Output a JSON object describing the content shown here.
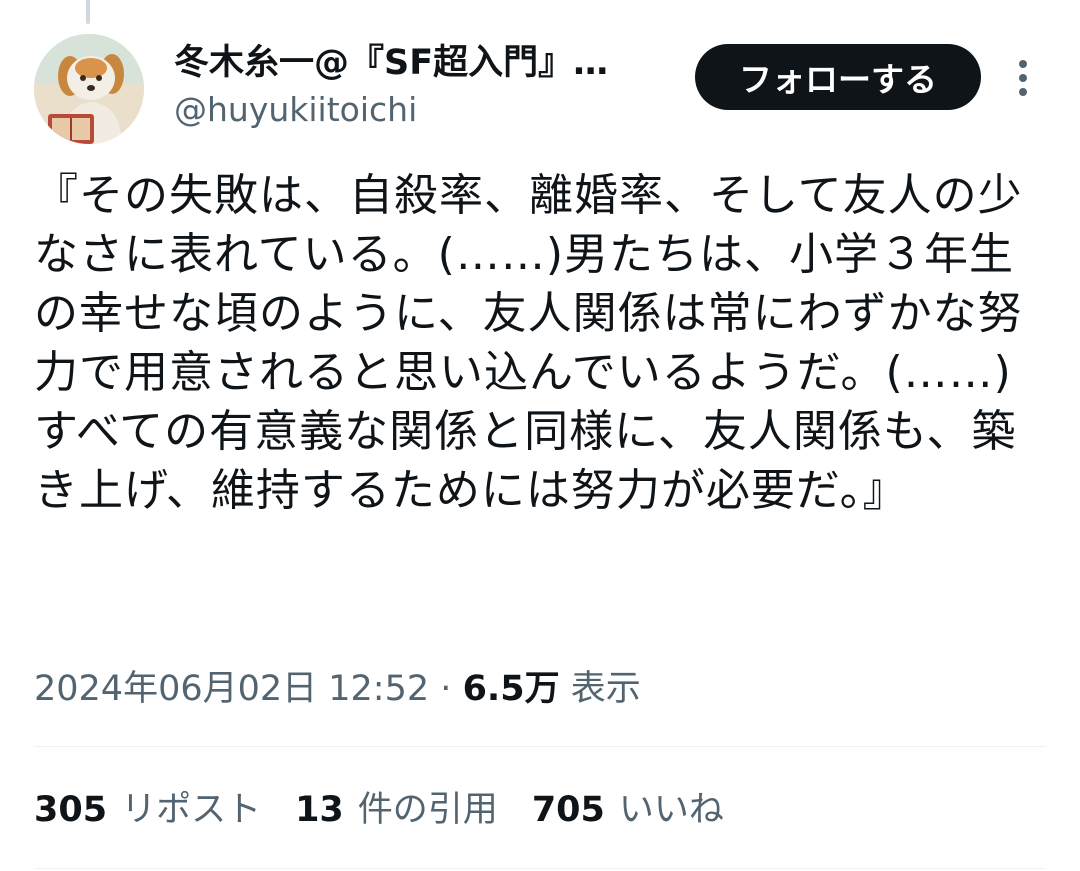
{
  "tweet": {
    "author": {
      "display_name": "冬木糸一@『SF超入門』…",
      "handle": "@huyukiitoichi"
    },
    "follow_label": "フォローする",
    "text": "『その失敗は、自殺率、離婚率、そして友人の少なさに表れている。(……)男たちは、小学３年生の幸せな頃のように、友人関係は常にわずかな努力で用意されると思い込んでいるようだ。(……)すべての有意義な関係と同様に、友人関係も、築き上げ、維持するためには努力が必要だ。』",
    "timestamp": "2024年06月02日 12:52",
    "separator": "·",
    "views_count": "6.5万",
    "views_label": "表示",
    "stats": {
      "reposts": {
        "count": "305",
        "label": "リポスト"
      },
      "quotes": {
        "count": "13",
        "label": "件の引用"
      },
      "likes": {
        "count": "705",
        "label": "いいね"
      }
    }
  },
  "colors": {
    "text_primary": "#0f1419",
    "text_secondary": "#536471",
    "follow_button_bg": "#0f1419",
    "follow_button_text": "#ffffff",
    "divider": "#eff3f4"
  },
  "icons": {
    "more": "more-vertical-icon"
  }
}
